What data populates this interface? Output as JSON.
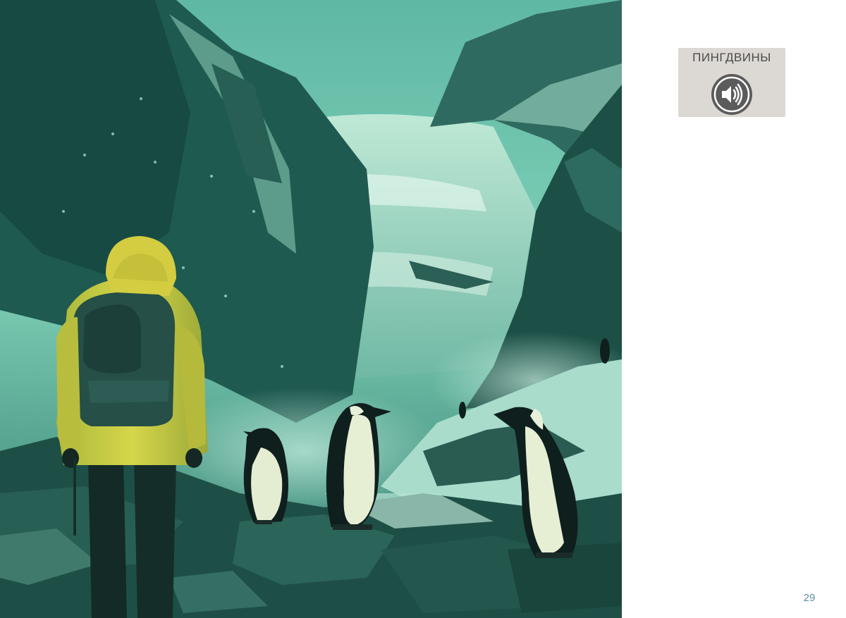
{
  "audio": {
    "label": "ПИНГДВИНЫ",
    "icon": "speaker-icon"
  },
  "illustration": {
    "subject": "illustration"
  },
  "page": {
    "number": "29"
  },
  "colors": {
    "card_background": "#dcd9d4",
    "button_background": "#5a5a5a",
    "page_number": "#5a8fa6"
  }
}
